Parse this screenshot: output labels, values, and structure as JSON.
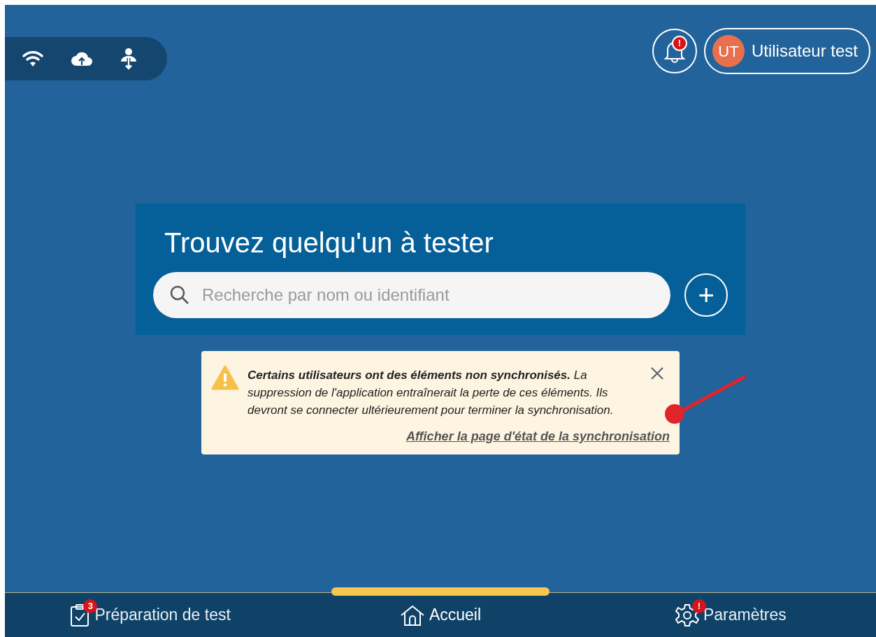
{
  "status_icons": [
    {
      "kind": "wifi"
    },
    {
      "kind": "cloud-upload"
    },
    {
      "kind": "user-download"
    }
  ],
  "header": {
    "notification_badge": "!",
    "user": {
      "initials": "UT",
      "name": "Utilisateur test"
    }
  },
  "search_panel": {
    "title": "Trouvez quelqu'un à tester",
    "placeholder": "Recherche par nom ou identifiant",
    "add_button": "+"
  },
  "alert": {
    "text": "**Certains utilisateurs ont des éléments non synchronisés.** La suppression de l'application entraînerait la perte de ces éléments. Ils devront se connecter ultérieurement pour terminer la synchronisation.",
    "link": "Afficher la page d'état de la synchronisation"
  },
  "bottom_nav": [
    {
      "kind": "clipboard",
      "label": "Préparation de test",
      "badge": "3",
      "selected": false
    },
    {
      "kind": "home",
      "label": "Accueil",
      "selected": true
    },
    {
      "kind": "gear",
      "label": "Paramètres",
      "badge": "!",
      "selected": false
    }
  ]
}
